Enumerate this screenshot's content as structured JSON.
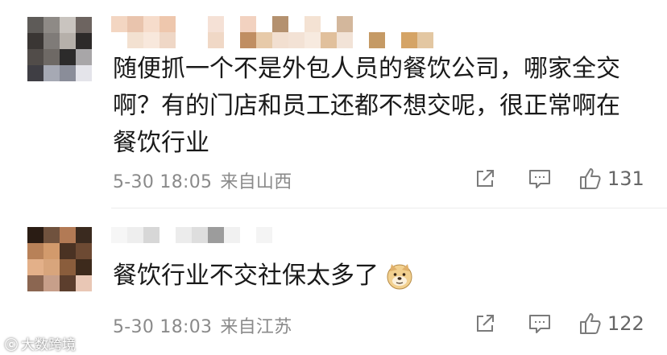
{
  "comments": [
    {
      "text": "随便抓一个不是外包人员的餐饮公司，哪家全交啊？有的门店和员工还都不想交呢，很正常啊在餐饮行业",
      "date": "5-30 18:05",
      "location": "来自山西",
      "like_count": "131",
      "avatar_colors": [
        "#5e5b58",
        "#8e8a86",
        "#c9c4bf",
        "#6d6460",
        "#3a3634",
        "#7f7b78",
        "#b6b0aa",
        "#2d2a29",
        "#514c49",
        "#6e6965",
        "#2c2b2b",
        "#a8a6a8",
        "#3f3e44",
        "#a6a9b4",
        "#8a8d99",
        "#e4e4ea"
      ],
      "name_colors_row1": [
        "#f3d6c2",
        "#e9c4ad",
        "#f6dccb",
        "#eec7ad",
        "#ffffff",
        "#ffffff",
        "#f5e1d6",
        "#ffffff",
        "#f2d2c0",
        "#ffffff",
        "#b4916f",
        "#ffffff",
        "#f4e2d3",
        "#ffffff",
        "#d3b79c",
        "#ffffff",
        "#ffffff",
        "#ffffff",
        "#ffffff",
        "#ffffff"
      ],
      "name_colors_row2": [
        "#ffffff",
        "#f3e1d1",
        "#f8e8dc",
        "#efd7c6",
        "#ffffff",
        "#ffffff",
        "#f0d8c6",
        "#ffffff",
        "#c08e62",
        "#e7caa9",
        "#f2dfd0",
        "#f3e2d5",
        "#f7eadf",
        "#e1c09c",
        "#f2e3d7",
        "#ffffff",
        "#c59a65",
        "#ffffff",
        "#d5a466",
        "#e3c7a2"
      ]
    },
    {
      "text": "餐饮行业不交社保太多了",
      "date": "5-30 18:03",
      "location": "来自江苏",
      "like_count": "122",
      "avatar_colors": [
        "#2a1c14",
        "#70523e",
        "#b27a55",
        "#3a2a1f",
        "#b88158",
        "#d29a6c",
        "#4a3223",
        "#6d4a33",
        "#e3b089",
        "#d8a57c",
        "#8a5d3c",
        "#3d2a1c",
        "#8b6651",
        "#c79f8a",
        "#5c3e2d",
        "#e9c7b5"
      ],
      "name_colors_row1": [
        "#f6f6f6",
        "#eeeeee",
        "#d7d7d7",
        "#ffffff",
        "#ececec",
        "#dedede",
        "#9c9c9c",
        "#f1f1f1",
        "#ffffff",
        "#f4f4f4",
        "#ffffff"
      ]
    }
  ],
  "icons": {
    "share": "share-icon",
    "reply": "comment-icon",
    "like": "thumbs-up-icon",
    "emoji": "doge-emoji"
  },
  "watermark": {
    "logo": "ⓒ",
    "text": "大数跨境"
  }
}
